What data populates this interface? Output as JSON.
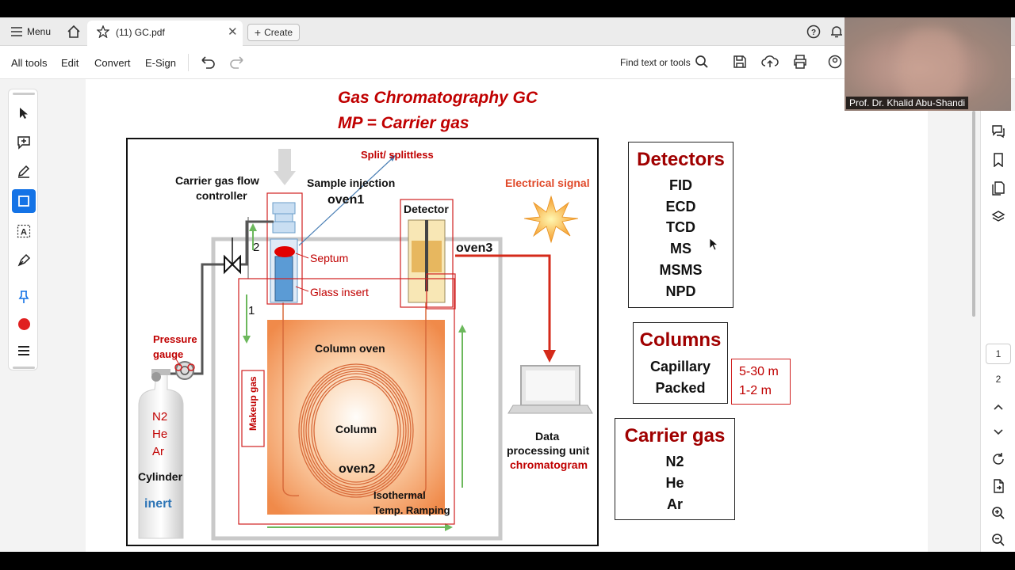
{
  "tabbar": {
    "menu_label": "Menu",
    "tab_title": "(11) GC.pdf",
    "create_label": "Create"
  },
  "toolbar": {
    "all_tools": "All tools",
    "edit": "Edit",
    "convert": "Convert",
    "esign": "E-Sign",
    "find_label": "Find text or tools"
  },
  "webcam": {
    "presenter": "Prof. Dr. Khalid Abu-Shandi"
  },
  "slide": {
    "title_line1": "Gas Chromatography GC",
    "title_line2": "MP = Carrier gas"
  },
  "diagram": {
    "split": "Split/ splittless",
    "flow_controller_1": "Carrier gas flow",
    "flow_controller_2": "controller",
    "sample_injection": "Sample injection",
    "oven1": "oven1",
    "detector": "Detector",
    "oven3": "oven3",
    "electrical_signal": "Electrical signal",
    "septum": "Septum",
    "glass_insert": "Glass insert",
    "num2": "2",
    "num1": "1",
    "pressure_1": "Pressure",
    "pressure_2": "gauge",
    "column_oven": "Column oven",
    "column": "Column",
    "oven2": "oven2",
    "makeup_gas": "Makeup gas",
    "isothermal": "Isothermal",
    "temp_ramping": "Temp. Ramping",
    "gas_n2": "N2",
    "gas_he": "He",
    "gas_ar": "Ar",
    "cylinder": "Cylinder",
    "inert": "inert",
    "data_1": "Data",
    "data_2": "processing unit",
    "chromatogram": "chromatogram"
  },
  "detectors_box": {
    "title": "Detectors",
    "items": [
      "FID",
      "ECD",
      "TCD",
      "MS",
      "MSMS",
      "NPD"
    ]
  },
  "columns_box": {
    "title": "Columns",
    "items": [
      "Capillary",
      "Packed"
    ],
    "lengths": [
      "5-30 m",
      "1-2 m"
    ]
  },
  "carrier_box": {
    "title": "Carrier gas",
    "items": [
      "N2",
      "He",
      "Ar"
    ]
  },
  "pages": {
    "page1": "1",
    "page2": "2"
  },
  "colors": {
    "accent_blue": "#1473e6",
    "slide_red": "#c00000"
  }
}
